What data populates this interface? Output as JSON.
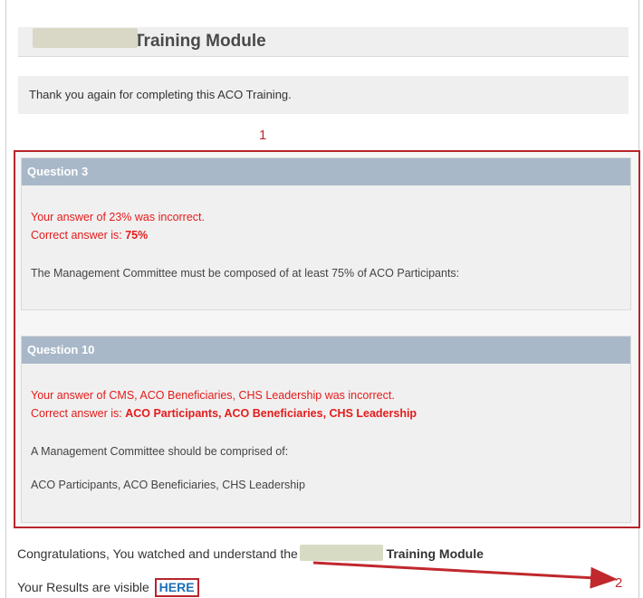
{
  "page": {
    "title_suffix": "Training Module",
    "thanks_message": "Thank you again for completing this ACO Training."
  },
  "annotations": {
    "marker_1": "1",
    "marker_2": "2"
  },
  "questions": [
    {
      "header": "Question 3",
      "your_answer_text": "Your answer of 23% was incorrect.",
      "correct_prefix": "Correct answer is:",
      "correct_value": "75%",
      "explanation": "The Management Committee must be composed of at least 75% of ACO Participants:"
    },
    {
      "header": "Question 10",
      "your_answer_text": "Your answer of CMS, ACO Beneficiaries, CHS Leadership was incorrect.",
      "correct_prefix": "Correct answer is:",
      "correct_value": "ACO Participants, ACO Beneficiaries, CHS Leadership",
      "explanation": "A Management Committee should be comprised of:",
      "explanation_detail": "ACO Participants, ACO Beneficiaries, CHS Leadership"
    }
  ],
  "footer": {
    "congrats_prefix": "Congratulations, You watched and understand the",
    "congrats_suffix": "Training Module",
    "results_prefix": "Your Results are visible",
    "results_link": "HERE"
  },
  "colors": {
    "question_header": "#a9b8c8",
    "incorrect_text": "#e51b1b",
    "annotation_red": "#b8252b",
    "link_blue": "#1b6fb8"
  }
}
